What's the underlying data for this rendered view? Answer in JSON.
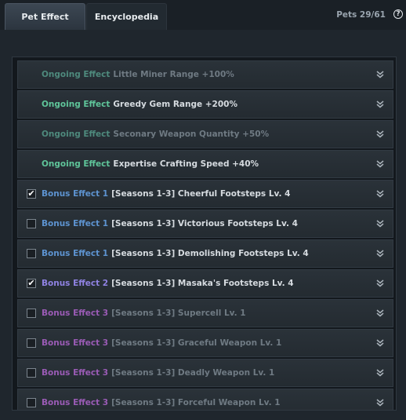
{
  "tabs": [
    {
      "label": "Pet Effect",
      "active": true
    },
    {
      "label": "Encyclopedia",
      "active": false
    }
  ],
  "pets_count": "Pets 29/61",
  "help_icon": "question-circle-icon",
  "rows": [
    {
      "label": "Ongoing Effect",
      "desc": "Little Miner Range +100%",
      "type": "ongoing",
      "dim": true,
      "checkbox": false,
      "checked": false
    },
    {
      "label": "Ongoing Effect",
      "desc": "Greedy Gem Range +200%",
      "type": "ongoing",
      "dim": false,
      "checkbox": false,
      "checked": false
    },
    {
      "label": "Ongoing Effect",
      "desc": "Seconary Weapon Quantity +50%",
      "type": "ongoing",
      "dim": true,
      "checkbox": false,
      "checked": false
    },
    {
      "label": "Ongoing Effect",
      "desc": "Expertise Crafting Speed +40%",
      "type": "ongoing",
      "dim": false,
      "checkbox": false,
      "checked": false
    },
    {
      "label": "Bonus Effect 1",
      "desc": "[Seasons 1-3] Cheerful Footsteps Lv. 4",
      "type": "b1",
      "dim": false,
      "checkbox": true,
      "checked": true
    },
    {
      "label": "Bonus Effect 1",
      "desc": "[Seasons 1-3] Victorious Footsteps Lv. 4",
      "type": "b1",
      "dim": false,
      "checkbox": true,
      "checked": false
    },
    {
      "label": "Bonus Effect 1",
      "desc": "[Seasons 1-3] Demolishing Footsteps Lv. 4",
      "type": "b1",
      "dim": false,
      "checkbox": true,
      "checked": false
    },
    {
      "label": "Bonus Effect 2",
      "desc": "[Seasons 1-3] Masaka's Footsteps Lv. 4",
      "type": "b2",
      "dim": false,
      "checkbox": true,
      "checked": true
    },
    {
      "label": "Bonus Effect 3",
      "desc": "[Seasons 1-3] Supercell Lv. 1",
      "type": "b3",
      "dim": true,
      "checkbox": true,
      "checked": false
    },
    {
      "label": "Bonus Effect 3",
      "desc": "[Seasons 1-3] Graceful Weapon Lv. 1",
      "type": "b3",
      "dim": true,
      "checkbox": true,
      "checked": false
    },
    {
      "label": "Bonus Effect 3",
      "desc": "[Seasons 1-3] Deadly Weapon Lv. 1",
      "type": "b3",
      "dim": true,
      "checkbox": true,
      "checked": false
    },
    {
      "label": "Bonus Effect 3",
      "desc": "[Seasons 1-3] Forceful Weapon Lv. 1",
      "type": "b3",
      "dim": true,
      "checkbox": true,
      "checked": false
    }
  ]
}
